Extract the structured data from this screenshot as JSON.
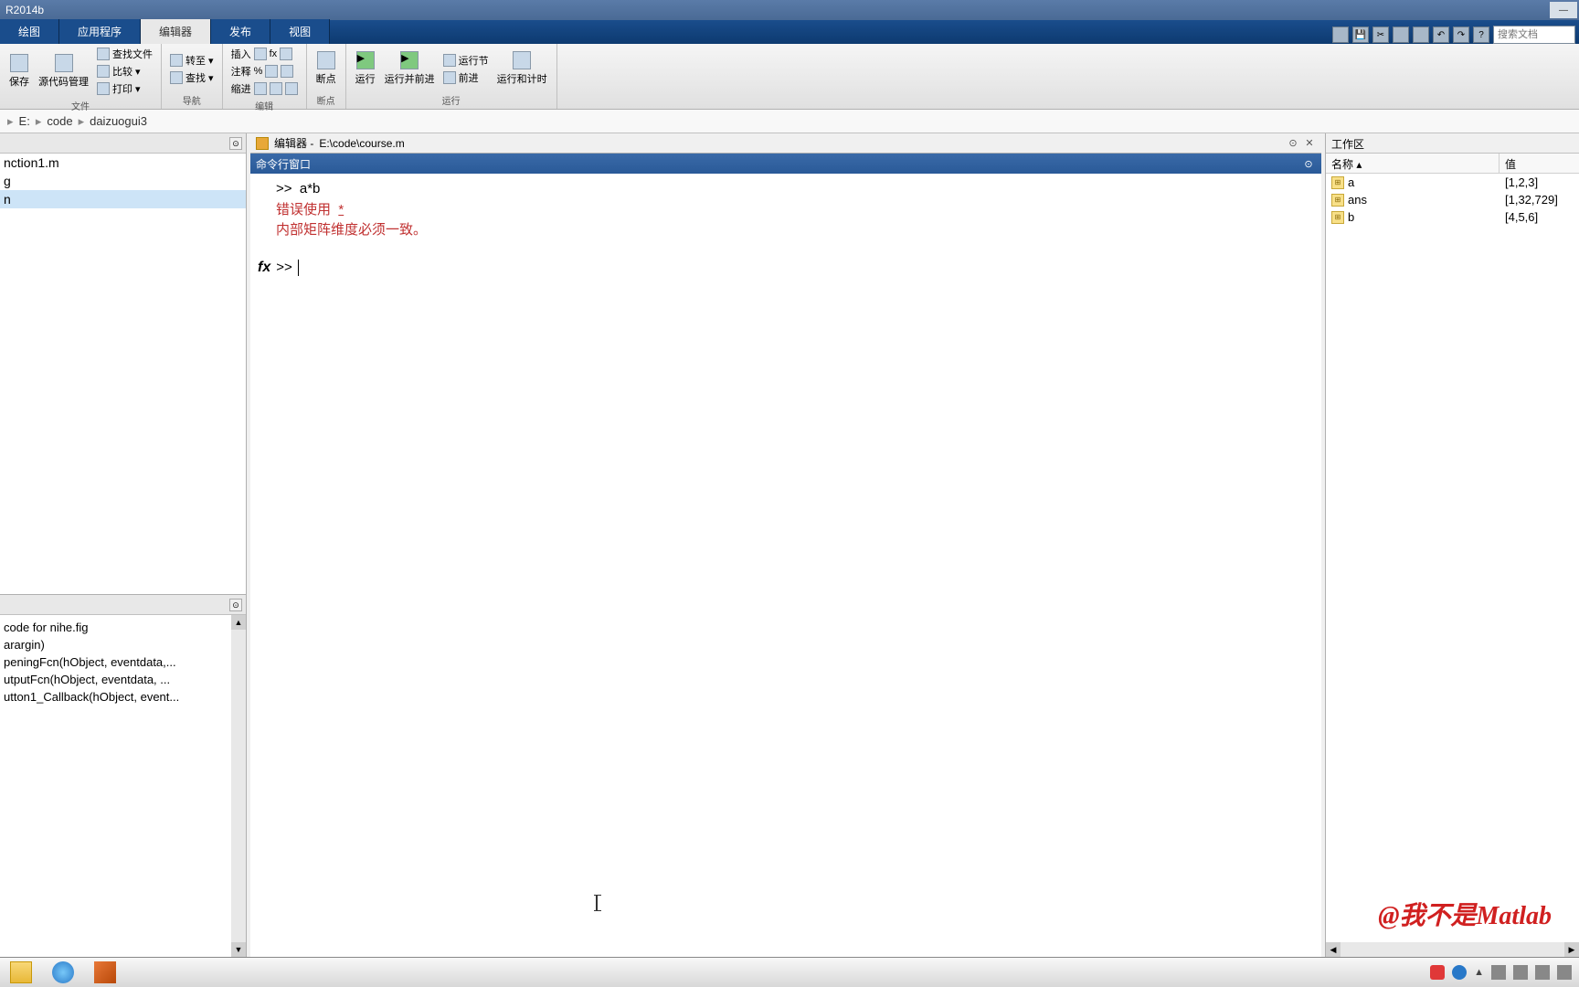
{
  "titlebar": {
    "app": "R2014b"
  },
  "tabs": {
    "items": [
      "绘图",
      "应用程序",
      "编辑器",
      "发布",
      "视图"
    ],
    "active_index": 2,
    "search_placeholder": "搜索文档"
  },
  "ribbon": {
    "groups": [
      {
        "label": "文件",
        "big": [
          {
            "label": "保存"
          },
          {
            "label": "源代码管理"
          }
        ],
        "small": [
          "查找文件",
          "比较 ▾",
          "打印 ▾"
        ]
      },
      {
        "label": "导航",
        "small_cols": [
          [
            "插入",
            "注释",
            "缩进"
          ],
          [
            "",
            "",
            ""
          ],
          [
            "fx",
            "%",
            "▸"
          ],
          [
            "",
            "",
            ""
          ]
        ],
        "right": [
          "转至 ▾",
          "查找 ▾"
        ]
      },
      {
        "label": "编辑",
        "small": []
      },
      {
        "label": "断点",
        "big": [
          {
            "label": "断点"
          }
        ]
      },
      {
        "label": "运行",
        "big": [
          {
            "label": "运行"
          },
          {
            "label": "运行并前进"
          },
          {
            "label": "运行节",
            "sub": "前进"
          },
          {
            "label": "运行和计时"
          }
        ]
      }
    ]
  },
  "path": {
    "segments": [
      "E:",
      "code",
      "daizuogui3"
    ]
  },
  "file_browser": {
    "items": [
      {
        "name": "nction1.m",
        "selected": false
      },
      {
        "name": "g",
        "selected": false
      },
      {
        "name": "n",
        "selected": true
      }
    ]
  },
  "details": {
    "lines": [
      "code for nihe.fig",
      "arargin)",
      "peningFcn(hObject, eventdata,...",
      "utputFcn(hObject, eventdata, ...",
      "utton1_Callback(hObject, event..."
    ]
  },
  "editor": {
    "title_prefix": "编辑器 - ",
    "path": "E:\\code\\course.m"
  },
  "command_window": {
    "title": "命令行窗口",
    "history": [
      {
        "type": "prompt",
        "text": ">>  a*b"
      },
      {
        "type": "error",
        "text": "错误使用  ",
        "underline": "*",
        "suffix": "  "
      },
      {
        "type": "error",
        "text": "内部矩阵维度必须一致。"
      }
    ],
    "fx_prompt": ">>"
  },
  "workspace": {
    "title": "工作区",
    "col_name": "名称 ▴",
    "col_value": "值",
    "vars": [
      {
        "name": "a",
        "value": "[1,2,3]"
      },
      {
        "name": "ans",
        "value": "[1,32,729]"
      },
      {
        "name": "b",
        "value": "[4,5,6]"
      }
    ]
  },
  "watermark": "@我不是Matlab"
}
